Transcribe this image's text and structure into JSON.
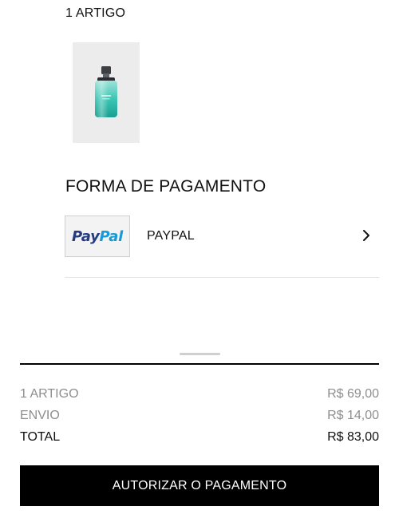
{
  "order": {
    "items_count_label": "1 ARTIGO"
  },
  "product": {
    "image_icon": "perfume-bottle-icon"
  },
  "payment": {
    "section_title": "FORMA DE PAGAMENTO",
    "method": {
      "logo_text_part1": "Pay",
      "logo_text_part2": "Pal",
      "label": "PAYPAL",
      "chevron_icon": "chevron-right-icon"
    }
  },
  "summary": {
    "items_label": "1 ARTIGO",
    "items_value": "R$ 69,00",
    "shipping_label": "ENVIO",
    "shipping_value": "R$ 14,00",
    "total_label": "TOTAL",
    "total_value": "R$ 83,00"
  },
  "actions": {
    "authorize_label": "AUTORIZAR O PAGAMENTO"
  },
  "colors": {
    "paypal_dark": "#253b80",
    "paypal_light": "#179bd7",
    "button_bg": "#000000",
    "muted_text": "#8e8e8e"
  }
}
